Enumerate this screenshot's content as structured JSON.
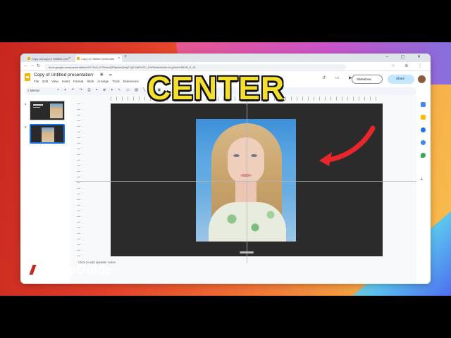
{
  "browser": {
    "tabs": [
      {
        "label": "Copy of Copy of Untitled pres"
      },
      {
        "label": "Copy of Untitled presentati"
      }
    ],
    "new_tab": "+",
    "window_controls": "– ▢ ✕",
    "url": "docs.google.com/presentation/d/1YDrH_KTNvwvQP9pNmQbtq27gE-0afD4ZC_PoRt/edit#slide=id.g2a4d1f8f1f0_0_91"
  },
  "app": {
    "doc_title": "Copy of Untitled presentation",
    "menu": [
      "File",
      "Edit",
      "View",
      "Insert",
      "Format",
      "Slide",
      "Arrange",
      "Tools",
      "Extensions"
    ],
    "slideshow_label": "Slideshow",
    "share_label": "Share",
    "search_menus": "Menus",
    "notes_placeholder": "Click to add speaker notes"
  },
  "filmstrip": {
    "slides": [
      {
        "number": "1"
      },
      {
        "number": "2"
      }
    ]
  },
  "overlay": {
    "headline": "CENTER",
    "brand": "AsapGuide"
  },
  "colors": {
    "headline": "#f4df2c",
    "arrow": "#e8262b",
    "share_button": "#c2e7ff",
    "selection_border": "#1a73e8"
  }
}
